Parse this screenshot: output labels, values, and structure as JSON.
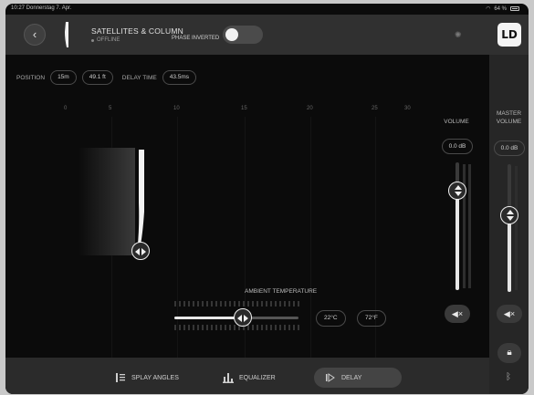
{
  "status_bar": {
    "time_date": "10:27  Donnerstag 7. Apr.",
    "battery": "64 %"
  },
  "header": {
    "device_title": "SATELLITES & COLUMN",
    "device_status": "OFFLINE",
    "phase_label": "PHASE INVERTED",
    "phase_inverted": false,
    "brand": "LD"
  },
  "params": {
    "position_label": "POSITION",
    "position_m": "15m",
    "position_ft": "49.1 ft",
    "delay_label": "DELAY TIME",
    "delay_value": "43.5ms"
  },
  "ruler": [
    "0",
    "5",
    "10",
    "15",
    "20",
    "25",
    "30"
  ],
  "ambient": {
    "label": "AMBIENT TEMPERATURE",
    "value_c": "22°C",
    "value_f": "72°F",
    "slider_fraction": 0.55
  },
  "volume": {
    "label": "VOLUME",
    "value": "0.0 dB",
    "level_fraction": 0.78
  },
  "master_volume": {
    "label": "MASTER VOLUME",
    "value": "0.0 dB",
    "level_fraction": 0.6
  },
  "tabs": [
    {
      "label": "SPLAY ANGLES",
      "active": false
    },
    {
      "label": "EQUALIZER",
      "active": false
    },
    {
      "label": "DELAY",
      "active": true
    }
  ],
  "icons": {
    "back": "chevron-left-icon",
    "mute": "speaker-mute-icon",
    "lock": "lock-icon",
    "bluetooth": "bluetooth-icon",
    "brightness": "sun-icon"
  }
}
